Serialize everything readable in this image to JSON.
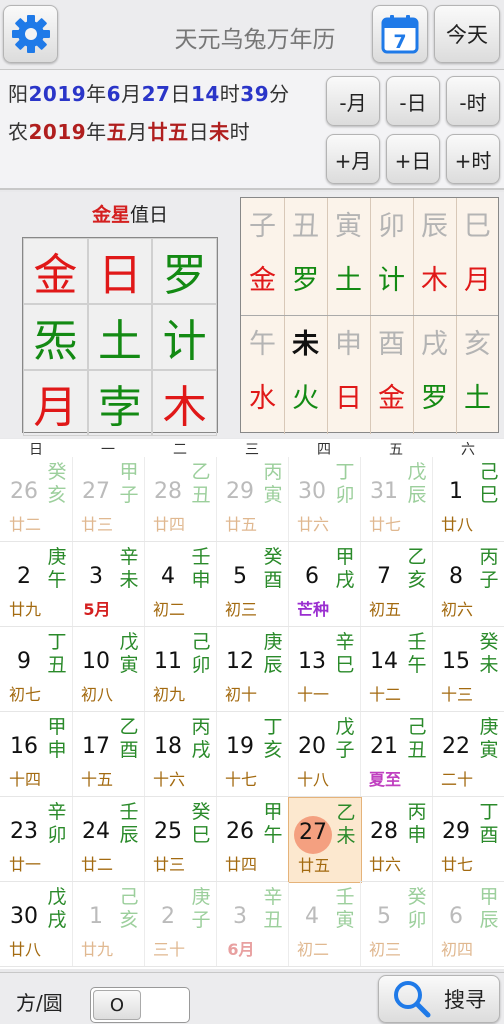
{
  "app": {
    "title": "天元乌兔万年历"
  },
  "toolbar": {
    "today_label": "今天",
    "calendar_day": "7"
  },
  "date": {
    "solar": {
      "prefix": "阳",
      "year": "2019",
      "y_unit": "年",
      "month": "6",
      "m_unit": "月",
      "day": "27",
      "d_unit": "日",
      "hour": "14",
      "h_unit": "时",
      "minute": "39",
      "min_unit": "分"
    },
    "lunar": {
      "prefix": "农",
      "year": "2019",
      "y_unit": "年",
      "month": "五",
      "m_unit": "月",
      "day": "廿五",
      "d_unit": "日",
      "hour": "未",
      "h_unit": "时"
    }
  },
  "nav": {
    "minus_month": "-月",
    "minus_day": "-日",
    "minus_hour": "-时",
    "plus_month": "+月",
    "plus_day": "+日",
    "plus_hour": "+时"
  },
  "duty": {
    "star": "金星",
    "suffix": "值日"
  },
  "stars_grid": [
    {
      "t": "金",
      "c": "#e01818"
    },
    {
      "t": "日",
      "c": "#e01818"
    },
    {
      "t": "罗",
      "c": "#138a13"
    },
    {
      "t": "炁",
      "c": "#138a13"
    },
    {
      "t": "土",
      "c": "#138a13"
    },
    {
      "t": "计",
      "c": "#138a13"
    },
    {
      "t": "月",
      "c": "#e01818"
    },
    {
      "t": "孛",
      "c": "#138a13"
    },
    {
      "t": "木",
      "c": "#e01818"
    }
  ],
  "branches": [
    {
      "branch": "子",
      "star": "金",
      "sc": "#e01818"
    },
    {
      "branch": "丑",
      "star": "罗",
      "sc": "#138a13"
    },
    {
      "branch": "寅",
      "star": "土",
      "sc": "#138a13"
    },
    {
      "branch": "卯",
      "star": "计",
      "sc": "#138a13"
    },
    {
      "branch": "辰",
      "star": "木",
      "sc": "#e01818"
    },
    {
      "branch": "巳",
      "star": "月",
      "sc": "#e01818"
    },
    {
      "branch": "午",
      "star": "水",
      "sc": "#e01818"
    },
    {
      "branch": "未",
      "star": "火",
      "sc": "#138a13",
      "current": true
    },
    {
      "branch": "申",
      "star": "日",
      "sc": "#e01818"
    },
    {
      "branch": "酉",
      "star": "金",
      "sc": "#e01818"
    },
    {
      "branch": "戌",
      "star": "罗",
      "sc": "#138a13"
    },
    {
      "branch": "亥",
      "star": "土",
      "sc": "#138a13"
    }
  ],
  "weekdays": [
    "日",
    "一",
    "二",
    "三",
    "四",
    "五",
    "六"
  ],
  "calendar": [
    {
      "d": "26",
      "gz": "癸亥",
      "lu": "廿二",
      "o": true
    },
    {
      "d": "27",
      "gz": "甲子",
      "lu": "廿三",
      "o": true
    },
    {
      "d": "28",
      "gz": "乙丑",
      "lu": "廿四",
      "o": true
    },
    {
      "d": "29",
      "gz": "丙寅",
      "lu": "廿五",
      "o": true
    },
    {
      "d": "30",
      "gz": "丁卯",
      "lu": "廿六",
      "o": true
    },
    {
      "d": "31",
      "gz": "戊辰",
      "lu": "廿七",
      "o": true
    },
    {
      "d": "1",
      "gz": "己巳",
      "lu": "廿八",
      "lc": "#a36a10"
    },
    {
      "d": "2",
      "gz": "庚午",
      "lu": "廿九",
      "lc": "#a36a10"
    },
    {
      "d": "3",
      "gz": "辛未",
      "lu": "5月",
      "lc": "#d42020"
    },
    {
      "d": "4",
      "gz": "壬申",
      "lu": "初二",
      "lc": "#a36a10"
    },
    {
      "d": "5",
      "gz": "癸酉",
      "lu": "初三",
      "lc": "#a36a10"
    },
    {
      "d": "6",
      "gz": "甲戌",
      "lu": "芒种",
      "lc": "#9a2ed0"
    },
    {
      "d": "7",
      "gz": "乙亥",
      "lu": "初五",
      "lc": "#a36a10"
    },
    {
      "d": "8",
      "gz": "丙子",
      "lu": "初六",
      "lc": "#a36a10"
    },
    {
      "d": "9",
      "gz": "丁丑",
      "lu": "初七",
      "lc": "#a36a10"
    },
    {
      "d": "10",
      "gz": "戊寅",
      "lu": "初八",
      "lc": "#a36a10"
    },
    {
      "d": "11",
      "gz": "己卯",
      "lu": "初九",
      "lc": "#a36a10"
    },
    {
      "d": "12",
      "gz": "庚辰",
      "lu": "初十",
      "lc": "#a36a10"
    },
    {
      "d": "13",
      "gz": "辛巳",
      "lu": "十一",
      "lc": "#a36a10"
    },
    {
      "d": "14",
      "gz": "壬午",
      "lu": "十二",
      "lc": "#a36a10"
    },
    {
      "d": "15",
      "gz": "癸未",
      "lu": "十三",
      "lc": "#a36a10"
    },
    {
      "d": "16",
      "gz": "甲申",
      "lu": "十四",
      "lc": "#a36a10"
    },
    {
      "d": "17",
      "gz": "乙酉",
      "lu": "十五",
      "lc": "#a36a10"
    },
    {
      "d": "18",
      "gz": "丙戌",
      "lu": "十六",
      "lc": "#a36a10"
    },
    {
      "d": "19",
      "gz": "丁亥",
      "lu": "十七",
      "lc": "#a36a10"
    },
    {
      "d": "20",
      "gz": "戊子",
      "lu": "十八",
      "lc": "#a36a10"
    },
    {
      "d": "21",
      "gz": "己丑",
      "lu": "夏至",
      "lc": "#c040c0"
    },
    {
      "d": "22",
      "gz": "庚寅",
      "lu": "二十",
      "lc": "#a36a10"
    },
    {
      "d": "23",
      "gz": "辛卯",
      "lu": "廿一",
      "lc": "#a36a10"
    },
    {
      "d": "24",
      "gz": "壬辰",
      "lu": "廿二",
      "lc": "#a36a10"
    },
    {
      "d": "25",
      "gz": "癸巳",
      "lu": "廿三",
      "lc": "#a36a10"
    },
    {
      "d": "26",
      "gz": "甲午",
      "lu": "廿四",
      "lc": "#a36a10"
    },
    {
      "d": "27",
      "gz": "乙未",
      "lu": "廿五",
      "lc": "#a36a10",
      "today": true
    },
    {
      "d": "28",
      "gz": "丙申",
      "lu": "廿六",
      "lc": "#a36a10"
    },
    {
      "d": "29",
      "gz": "丁酉",
      "lu": "廿七",
      "lc": "#a36a10"
    },
    {
      "d": "30",
      "gz": "戊戌",
      "lu": "廿八",
      "lc": "#a36a10"
    },
    {
      "d": "1",
      "gz": "己亥",
      "lu": "廿九",
      "o": true
    },
    {
      "d": "2",
      "gz": "庚子",
      "lu": "三十",
      "o": true
    },
    {
      "d": "3",
      "gz": "辛丑",
      "lu": "6月",
      "o": true,
      "lc": "#e8a0a0"
    },
    {
      "d": "4",
      "gz": "壬寅",
      "lu": "初二",
      "o": true
    },
    {
      "d": "5",
      "gz": "癸卯",
      "lu": "初三",
      "o": true
    },
    {
      "d": "6",
      "gz": "甲辰",
      "lu": "初四",
      "o": true
    }
  ],
  "bottom": {
    "mode_label": "方/圆",
    "toggle_value": "O",
    "search_label": "搜寻"
  }
}
